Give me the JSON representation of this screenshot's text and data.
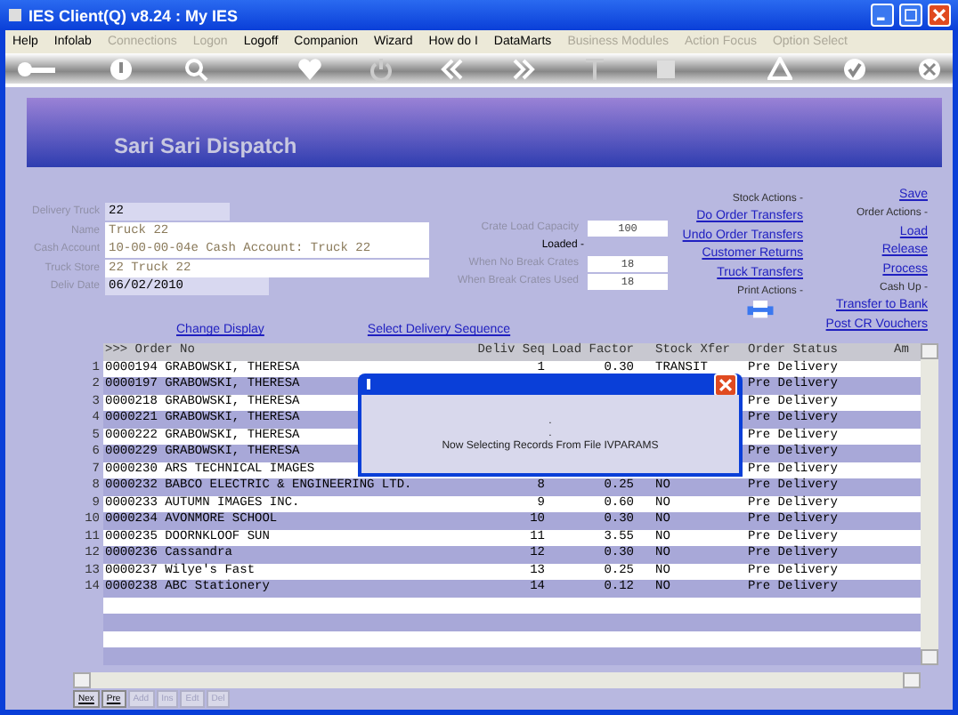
{
  "window": {
    "title": "IES Client(Q) v8.24 : My IES"
  },
  "menu": [
    {
      "label": "Help",
      "disabled": false
    },
    {
      "label": "Infolab",
      "disabled": false
    },
    {
      "label": "Connections",
      "disabled": true
    },
    {
      "label": "Logon",
      "disabled": true
    },
    {
      "label": "Logoff",
      "disabled": false
    },
    {
      "label": "Companion",
      "disabled": false
    },
    {
      "label": "Wizard",
      "disabled": false
    },
    {
      "label": "How do I",
      "disabled": false
    },
    {
      "label": "DataMarts",
      "disabled": false
    },
    {
      "label": "Business Modules",
      "disabled": true
    },
    {
      "label": "Action Focus",
      "disabled": true
    },
    {
      "label": "Option Select",
      "disabled": true
    }
  ],
  "banner": {
    "title": "Sari Sari Dispatch"
  },
  "form": {
    "left": [
      {
        "label": "Delivery Truck",
        "value": "22",
        "readonly": false
      },
      {
        "label": "Name",
        "value": "Truck 22",
        "readonly": true
      },
      {
        "label": "Cash Account",
        "value": "10-00-00-04e Cash Account: Truck 22",
        "readonly": true
      },
      {
        "label": "Truck Store",
        "value": "22 Truck 22",
        "readonly": true
      },
      {
        "label": "Deliv Date",
        "value": "06/02/2010",
        "readonly": false
      }
    ],
    "middle": [
      {
        "kind": "field",
        "label": "Crate Load Capacity",
        "value": "100"
      },
      {
        "kind": "heading",
        "label": "Loaded -"
      },
      {
        "kind": "field",
        "label": "When No Break Crates",
        "value": "18"
      },
      {
        "kind": "field",
        "label": "When Break Crates Used",
        "value": "18"
      }
    ]
  },
  "actions": [
    {
      "kind": "heading",
      "label": "Stock Actions -"
    },
    {
      "kind": "link",
      "label": "Do Order Transfers"
    },
    {
      "kind": "link",
      "label": "Undo Order Transfers"
    },
    {
      "kind": "link",
      "label": "Customer Returns"
    },
    {
      "kind": "link",
      "label": "Truck Transfers"
    },
    {
      "kind": "heading",
      "label": "Print Actions -"
    },
    {
      "kind": "printer"
    }
  ],
  "side_actions": [
    {
      "kind": "link",
      "label": "Save"
    },
    {
      "kind": "heading",
      "label": "Order Actions -"
    },
    {
      "kind": "link",
      "label": "Load"
    },
    {
      "kind": "link",
      "label": "Release"
    },
    {
      "kind": "link",
      "label": "Process"
    },
    {
      "kind": "heading",
      "label": "Cash Up -"
    },
    {
      "kind": "link",
      "label": "Transfer to Bank"
    },
    {
      "kind": "link",
      "label": "Post CR Vouchers"
    }
  ],
  "table_links": [
    "Change Display",
    "Select Delivery Sequence"
  ],
  "table": {
    "columns": [
      ">>> Order No",
      "Deliv Seq",
      "Load Factor",
      "Stock Xfer",
      "Order Status",
      "Am"
    ],
    "rows": [
      {
        "n": "1",
        "order": "0000194 GRABOWSKI, THERESA",
        "deliv_seq": "1",
        "load_factor": "0.30",
        "stock_xfer": "TRANSIT",
        "status": "Pre Delivery"
      },
      {
        "n": "2",
        "order": "0000197 GRABOWSKI, THERESA",
        "status": "Pre Delivery"
      },
      {
        "n": "3",
        "order": "0000218 GRABOWSKI, THERESA",
        "status": "Pre Delivery"
      },
      {
        "n": "4",
        "order": "0000221 GRABOWSKI, THERESA",
        "status": "Pre Delivery"
      },
      {
        "n": "5",
        "order": "0000222 GRABOWSKI, THERESA",
        "status": "Pre Delivery"
      },
      {
        "n": "6",
        "order": "0000229 GRABOWSKI, THERESA",
        "status": "Pre Delivery"
      },
      {
        "n": "7",
        "order": "0000230 ARS TECHNICAL IMAGES",
        "status": "Pre Delivery"
      },
      {
        "n": "8",
        "order": "0000232 BABCO ELECTRIC & ENGINEERING LTD.",
        "deliv_seq": "8",
        "load_factor": "0.25",
        "stock_xfer": "NO",
        "status": "Pre Delivery"
      },
      {
        "n": "9",
        "order": "0000233 AUTUMN IMAGES INC.",
        "deliv_seq": "9",
        "load_factor": "0.60",
        "stock_xfer": "NO",
        "status": "Pre Delivery"
      },
      {
        "n": "10",
        "order": "0000234 AVONMORE SCHOOL",
        "deliv_seq": "10",
        "load_factor": "0.30",
        "stock_xfer": "NO",
        "status": "Pre Delivery"
      },
      {
        "n": "11",
        "order": "0000235 DOORNKLOOF SUN",
        "deliv_seq": "11",
        "load_factor": "3.55",
        "stock_xfer": "NO",
        "status": "Pre Delivery"
      },
      {
        "n": "12",
        "order": "0000236 Cassandra",
        "deliv_seq": "12",
        "load_factor": "0.30",
        "stock_xfer": "NO",
        "status": "Pre Delivery"
      },
      {
        "n": "13",
        "order": "0000237 Wilye's Fast",
        "deliv_seq": "13",
        "load_factor": "0.25",
        "stock_xfer": "NO",
        "status": "Pre Delivery"
      },
      {
        "n": "14",
        "order": "0000238 ABC Stationery",
        "deliv_seq": "14",
        "load_factor": "0.12",
        "stock_xfer": "NO",
        "status": "Pre Delivery"
      }
    ]
  },
  "record_tabs": [
    {
      "label": "Nex",
      "disabled": false
    },
    {
      "label": "Pre",
      "disabled": false
    },
    {
      "label": "Add",
      "disabled": true
    },
    {
      "label": "Ins",
      "disabled": true
    },
    {
      "label": "Edt",
      "disabled": true
    },
    {
      "label": "Del",
      "disabled": true
    }
  ],
  "dialog": {
    "lines": [
      ".",
      "."
    ],
    "message": "Now Selecting Records From File IVPARAMS"
  }
}
